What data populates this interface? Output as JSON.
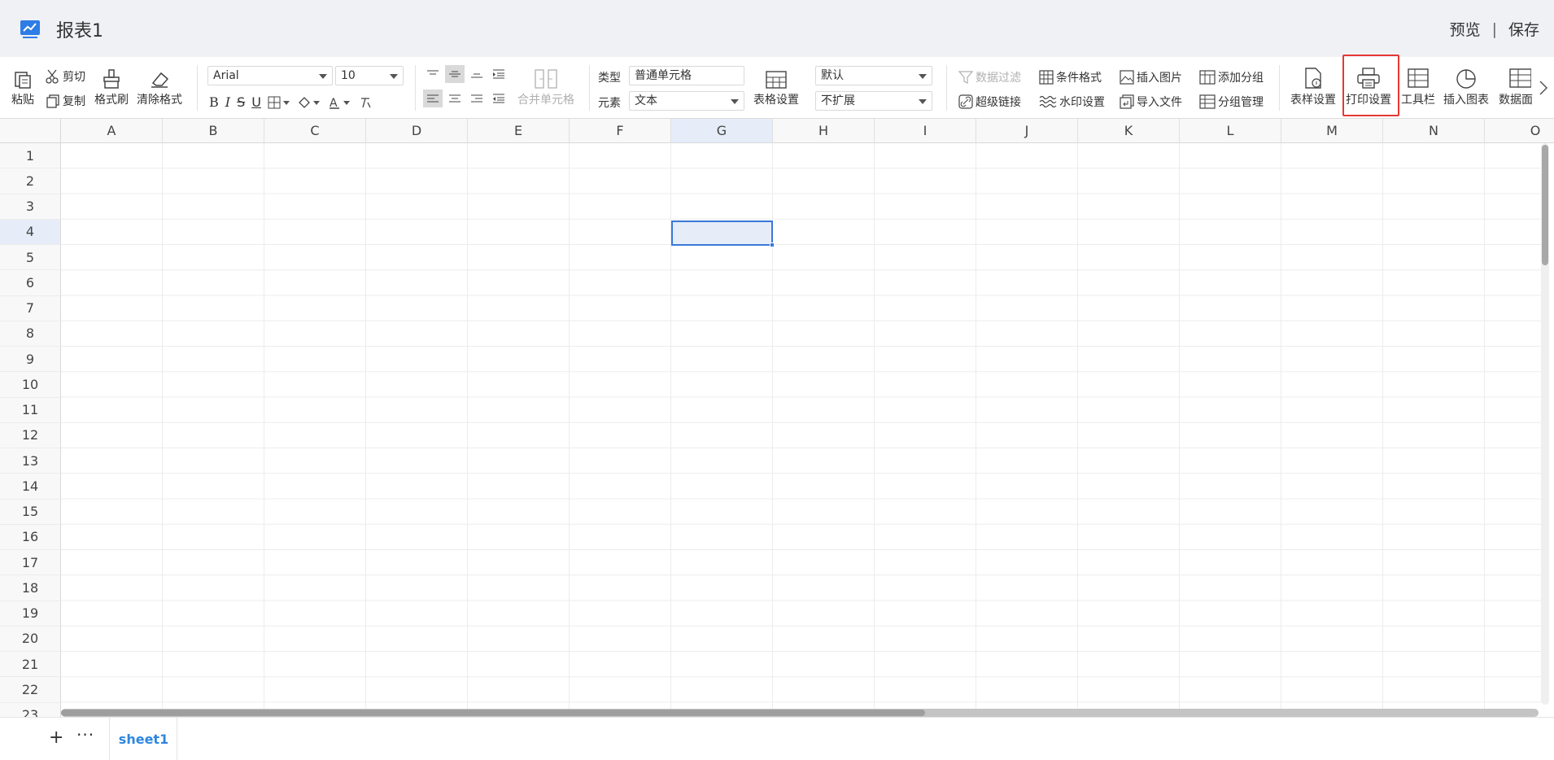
{
  "header": {
    "title": "报表1",
    "preview": "预览",
    "separator": "|",
    "save": "保存"
  },
  "toolbar": {
    "paste": "粘贴",
    "cut": "剪切",
    "copy": "复制",
    "format_painter": "格式刷",
    "clear_format": "清除格式",
    "font_family": "Arial",
    "font_size": "10",
    "merge_cells": "合并单元格",
    "type_label": "类型",
    "type_value": "普通单元格",
    "element_label": "元素",
    "element_value": "文本",
    "table_settings": "表格设置",
    "default_value": "默认",
    "expand_value": "不扩展",
    "data_filter": "数据过滤",
    "hyperlink": "超级链接",
    "conditional_format": "条件格式",
    "watermark": "水印设置",
    "insert_image": "插入图片",
    "import_file": "导入文件",
    "add_group": "添加分组",
    "group_manage": "分组管理",
    "style_settings": "表样设置",
    "print_settings": "打印设置",
    "toolbar_toggle": "工具栏",
    "insert_chart": "插入图表",
    "data_panel": "数据面"
  },
  "grid": {
    "columns": [
      "A",
      "B",
      "C",
      "D",
      "E",
      "F",
      "G",
      "H",
      "I",
      "J",
      "K",
      "L",
      "M",
      "N",
      "O"
    ],
    "rows": [
      "1",
      "2",
      "3",
      "4",
      "5",
      "6",
      "7",
      "8",
      "9",
      "10",
      "11",
      "12",
      "13",
      "14",
      "15",
      "16",
      "17",
      "18",
      "19",
      "20",
      "21",
      "22",
      "23"
    ],
    "selected_column": "G",
    "selected_row": "4"
  },
  "sheets": {
    "add": "+",
    "more": "···",
    "tabs": [
      "sheet1"
    ]
  },
  "colors": {
    "accent": "#3a78d8",
    "highlight_border": "#e53935",
    "tab_active": "#2e86de"
  }
}
